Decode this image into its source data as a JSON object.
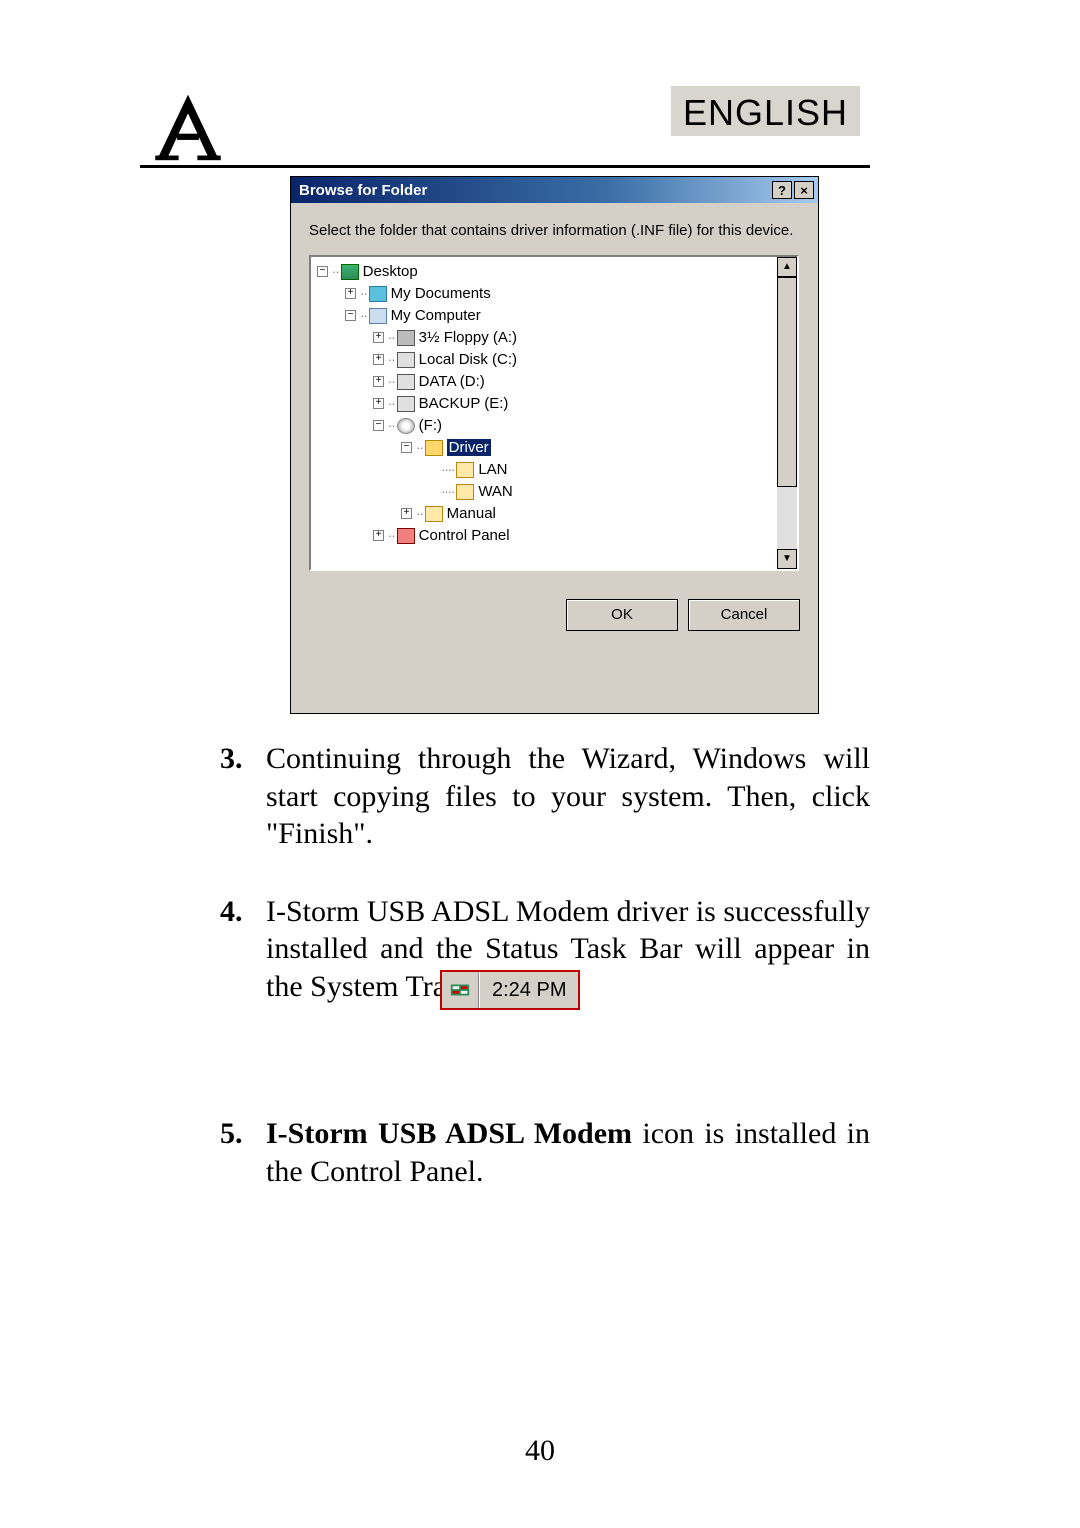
{
  "header": {
    "language": "ENGLISH"
  },
  "dialog": {
    "title": "Browse for Folder",
    "help_glyph": "?",
    "close_glyph": "×",
    "instruction": "Select the folder that contains driver information (.INF file) for this device.",
    "tree": {
      "desktop": "Desktop",
      "my_documents": "My Documents",
      "my_computer": "My Computer",
      "floppy": "3½ Floppy (A:)",
      "local_disk": "Local Disk (C:)",
      "data": "DATA (D:)",
      "backup": "BACKUP (E:)",
      "drive_f": "(F:)",
      "driver": "Driver",
      "lan": "LAN",
      "wan": "WAN",
      "manual": "Manual",
      "control_panel": "Control Panel"
    },
    "scroll": {
      "up_glyph": "▲",
      "down_glyph": "▼"
    },
    "ok": "OK",
    "cancel": "Cancel"
  },
  "steps": {
    "s3_num": "3.",
    "s3_text": "Continuing through the Wizard, Windows will start copying files to your system. Then, click \"Finish\".",
    "s4_num": "4.",
    "s4_text": "I-Storm USB ADSL Modem driver is successfully installed and the Status Task Bar will appear in the System Tray.",
    "s5_num": "5.",
    "s5_lead": "I-Storm USB ADSL Modem",
    "s5_tail": " icon is installed in the Control Panel."
  },
  "tray": {
    "time": "2:24 PM"
  },
  "page_number": "40"
}
